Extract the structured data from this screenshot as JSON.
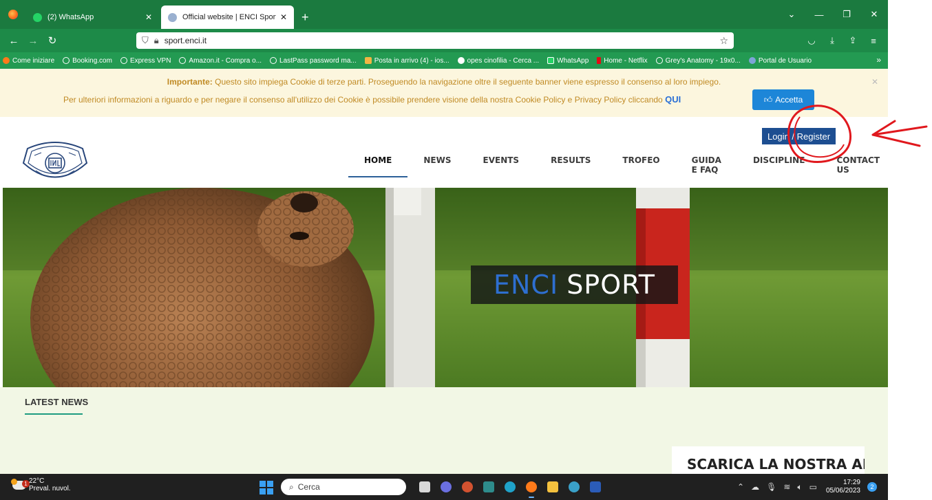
{
  "browser": {
    "tabs": [
      {
        "title": "(2) WhatsApp",
        "active": false
      },
      {
        "title": "Official website | ENCI Sport",
        "active": true
      }
    ],
    "new_tab": "+",
    "url": "sport.enci.it",
    "bookmarks": [
      "Come iniziare",
      "Booking.com",
      "Express VPN",
      "Amazon.it - Compra o...",
      "LastPass password ma...",
      "Posta in arrivo (4) - ios...",
      "opes cinofilia - Cerca ...",
      "WhatsApp",
      "Home - Netflix",
      "Grey's Anatomy - 19x0...",
      "Portal de Usuario"
    ]
  },
  "cookie_banner": {
    "line1_bold": "Importante:",
    "line1_rest": " Questo sito impiega Cookie di terze parti. Proseguendo la navigazione oltre il seguente banner viene espresso il consenso al loro impiego.",
    "line2": "Per ulteriori informazioni a riguardo e per negare il consenso all'utilizzo dei Cookie è possibile prendere visione della nostra Cookie Policy e Privacy Policy cliccando ",
    "link": "QUI",
    "accept_label": "Accetta"
  },
  "site": {
    "login_label": "Login / Register",
    "menu": [
      {
        "label": "HOME",
        "active": true
      },
      {
        "label": "NEWS",
        "active": false
      },
      {
        "label": "EVENTS",
        "active": false
      },
      {
        "label": "RESULTS",
        "active": false
      },
      {
        "label": "TROFEO",
        "active": false
      },
      {
        "label": "GUIDA E FAQ",
        "active": false
      },
      {
        "label": "DISCIPLINE",
        "active": false
      },
      {
        "label": "CONTACT US",
        "active": false
      }
    ],
    "hero_word1": "ENCI",
    "hero_word2": "SPORT",
    "latest_news": "LATEST NEWS",
    "app_box": "SCARICA LA NOSTRA APP"
  },
  "taskbar": {
    "temperature": "22°C",
    "weather_text": "Preval. nuvol.",
    "weather_badge": "1",
    "search_placeholder": "Cerca",
    "time": "17:29",
    "date": "05/06/2023",
    "notifications": "2"
  }
}
